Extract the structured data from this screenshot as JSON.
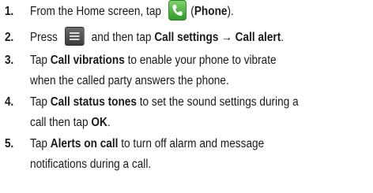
{
  "steps": [
    {
      "num": "1.",
      "parts": [
        "From the Home screen, tap",
        "(",
        "Phone",
        ")."
      ],
      "icon": "phone-icon"
    },
    {
      "num": "2.",
      "parts": [
        "Press",
        "and then tap",
        "Call settings → Call alert",
        "."
      ],
      "icon": "menu-icon"
    },
    {
      "num": "3.",
      "parts": [
        "Tap",
        "Call vibrations",
        "to enable your phone to vibrate",
        "when the called party answers the phone."
      ]
    },
    {
      "num": "4.",
      "parts": [
        "Tap",
        "Call status tones",
        "to set the sound settings during a",
        "call then tap",
        "OK",
        "."
      ]
    },
    {
      "num": "5.",
      "parts": [
        "Tap",
        "Alerts on call",
        "to turn off alarm and message",
        "notifications during a call."
      ]
    }
  ],
  "colors": {
    "phone_icon": "#3fae36",
    "menu_icon": "#4a4a4a"
  }
}
